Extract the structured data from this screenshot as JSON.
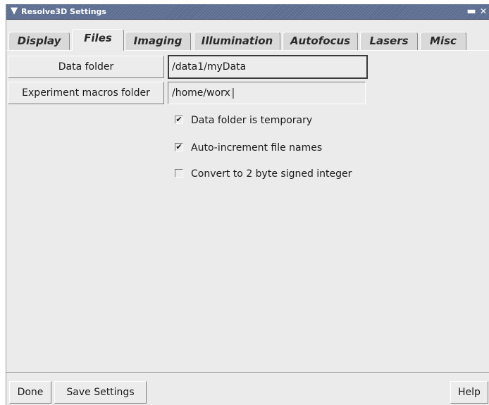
{
  "window": {
    "title": "Resolve3D Settings"
  },
  "tabs": [
    {
      "label": "Display",
      "active": false
    },
    {
      "label": "Files",
      "active": true
    },
    {
      "label": "Imaging",
      "active": false
    },
    {
      "label": "Illumination",
      "active": false
    },
    {
      "label": "Autofocus",
      "active": false
    },
    {
      "label": "Lasers",
      "active": false
    },
    {
      "label": "Misc",
      "active": false
    }
  ],
  "files": {
    "data_folder_button": "Data folder",
    "data_folder_value": "/data1/myData",
    "macros_folder_button": "Experiment macros folder",
    "macros_folder_value": "/home/worx",
    "options": [
      {
        "label": "Data folder is temporary",
        "checked": true
      },
      {
        "label": "Auto-increment file names",
        "checked": true
      },
      {
        "label": "Convert to 2 byte signed integer",
        "checked": false
      }
    ]
  },
  "footer": {
    "done_label": "Done",
    "save_label": "Save Settings",
    "help_label": "Help"
  },
  "icons": {
    "window_menu": "chevron-down-icon",
    "minimize": "minimize-icon",
    "close": "close-icon",
    "check": "checkmark-icon"
  }
}
